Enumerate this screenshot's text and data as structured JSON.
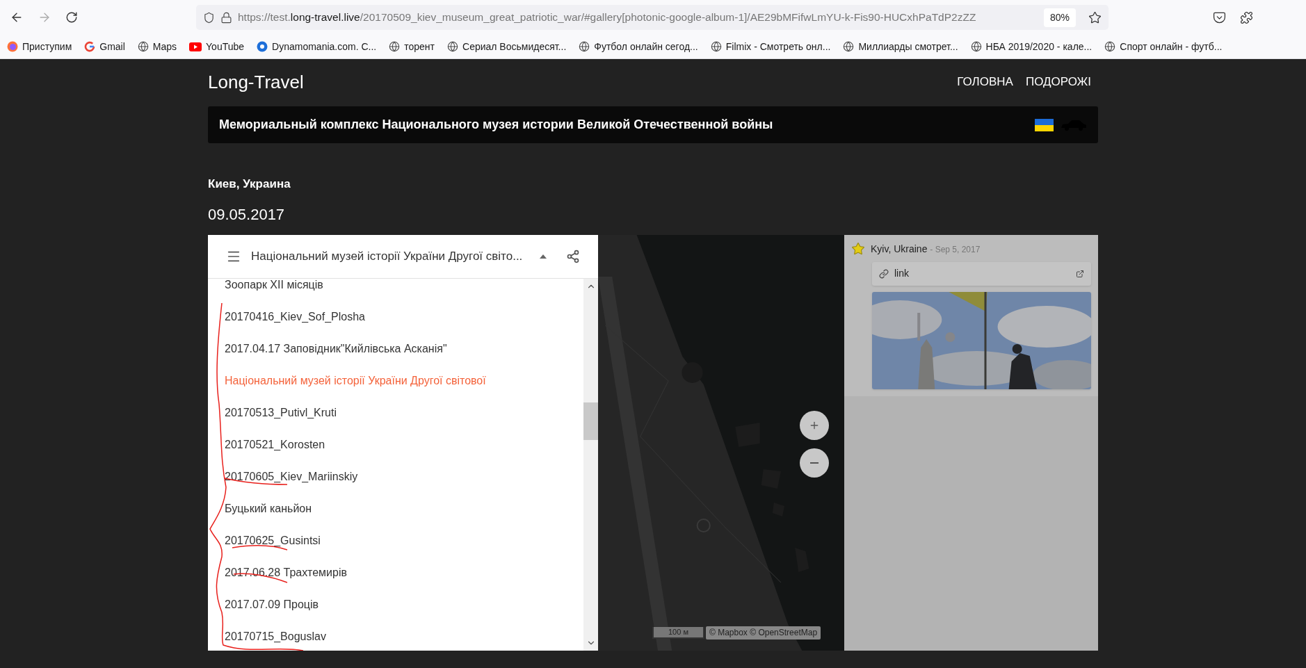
{
  "browser": {
    "url": {
      "prefix": "https://test.",
      "domain": "long-travel.live",
      "path": "/20170509_kiev_museum_great_patriotic_war/#gallery[photonic-google-album-1]/AE29bMFifwLmYU-k-Fis90-HUCxhPaTdP2zZZ"
    },
    "zoom": "80%",
    "bookmarks": [
      {
        "kind": "firefox",
        "label": "Приступим"
      },
      {
        "kind": "google",
        "label": "Gmail"
      },
      {
        "kind": "globe",
        "label": "Maps"
      },
      {
        "kind": "youtube",
        "label": "YouTube"
      },
      {
        "kind": "ball",
        "label": "Dynamomania.com. C..."
      },
      {
        "kind": "globe",
        "label": "торент"
      },
      {
        "kind": "globe",
        "label": "Сериал Восьмидесят..."
      },
      {
        "kind": "globe",
        "label": "Футбол онлайн сегод..."
      },
      {
        "kind": "globe",
        "label": "Filmix - Смотреть онл..."
      },
      {
        "kind": "globe",
        "label": "Миллиарды смотрет..."
      },
      {
        "kind": "globe",
        "label": "НБА 2019/2020 - кале..."
      },
      {
        "kind": "globe",
        "label": "Спорт онлайн - футб..."
      }
    ]
  },
  "site": {
    "logo": "Long-Travel",
    "nav": [
      "ГОЛОВНА",
      "ПОДОРОЖІ"
    ],
    "banner_title": "Мемориальный комплекс Национального музея истории Великой Отечественной войны",
    "location": "Киев, Украина",
    "date": "09.05.2017"
  },
  "gallery": {
    "album_title": "Національний музей історії України Другої світо...",
    "albums": [
      {
        "label": "Зоопарк XII місяців",
        "selected": false
      },
      {
        "label": "20170416_Kiev_Sof_Plosha",
        "selected": false
      },
      {
        "label": "2017.04.17 Заповідник\"Кийлівська Асканія\"",
        "selected": false
      },
      {
        "label": "Національний музей історії України Другої світової",
        "selected": true
      },
      {
        "label": "20170513_Putivl_Kruti",
        "selected": false
      },
      {
        "label": "20170521_Korosten",
        "selected": false
      },
      {
        "label": "20170605_Kiev_Mariinskiy",
        "selected": false
      },
      {
        "label": "Буцький каньйон",
        "selected": false
      },
      {
        "label": "20170625_Gusintsi",
        "selected": false
      },
      {
        "label": "2017.06.28 Трахтемирів",
        "selected": false
      },
      {
        "label": "2017.07.09 Проців",
        "selected": false
      },
      {
        "label": "20170715_Boguslav",
        "selected": false
      }
    ],
    "map": {
      "scale": "100 м",
      "attribution": "© Mapbox © OpenStreetMap"
    },
    "place": {
      "name": "Kyiv, Ukraine",
      "date": "- Sep 5, 2017",
      "link": "link"
    }
  }
}
